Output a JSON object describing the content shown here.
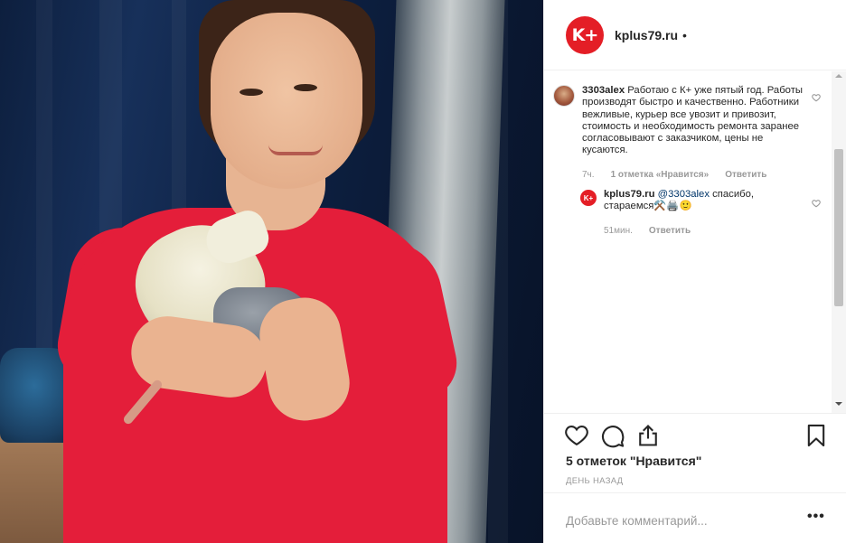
{
  "post": {
    "account": "kplus79.ru",
    "logo_text": "K+",
    "header_dot": "•"
  },
  "comments": [
    {
      "user": "3303alex",
      "text": "Работаю с К+ уже пятый год. Работы производят быстро и качественно. Работники вежливые, курьер все увозит и привозит, стоимость и необходимость ремонта заранее согласовывают с заказчиком, цены не кусаются.",
      "time": "7ч.",
      "likes": "1 отметка «Нравится»",
      "reply_label": "Ответить"
    }
  ],
  "reply": {
    "user": "kplus79.ru",
    "mention": "@3303alex",
    "text": " спасибо, стараемся⚒️🖨️🙂",
    "time": "51мин.",
    "reply_label": "Ответить",
    "avatar_text": "K+"
  },
  "actions": {
    "likes_count": "5 отметок \"Нравится\"",
    "posted": "День назад"
  },
  "comment_box": {
    "placeholder": "Добавьте комментарий...",
    "more_label": "•••"
  },
  "icons": [
    "heart-icon",
    "comment-icon",
    "share-icon",
    "bookmark-icon",
    "small-heart-icon"
  ]
}
